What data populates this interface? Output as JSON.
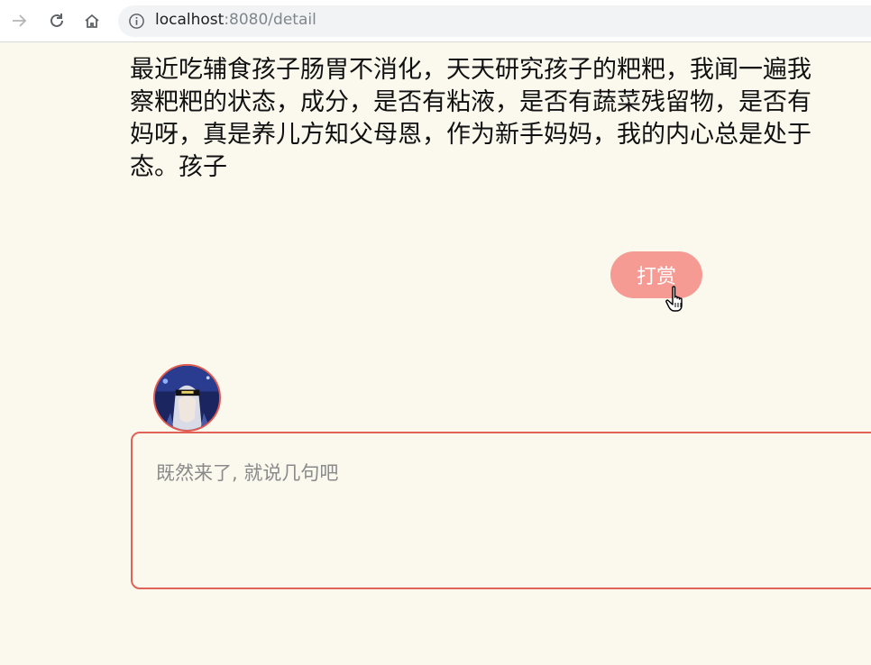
{
  "browser": {
    "url_host": "localhost",
    "url_rest": ":8080/detail"
  },
  "article": {
    "lines": [
      "最近吃辅食孩子肠胃不消化，天天研究孩子的粑粑，我闻一遍我",
      "察粑粑的状态，成分，是否有粘液，是否有蔬菜残留物，是否有",
      "妈呀，真是养儿方知父母恩，作为新手妈妈，我的内心总是处于",
      "态。孩子"
    ]
  },
  "tip": {
    "label": "打赏"
  },
  "comment": {
    "placeholder": "既然来了, 就说几句吧"
  },
  "colors": {
    "page_bg": "#fbf8ee",
    "tip_button": "#f69a94",
    "comment_border": "#e06258"
  }
}
